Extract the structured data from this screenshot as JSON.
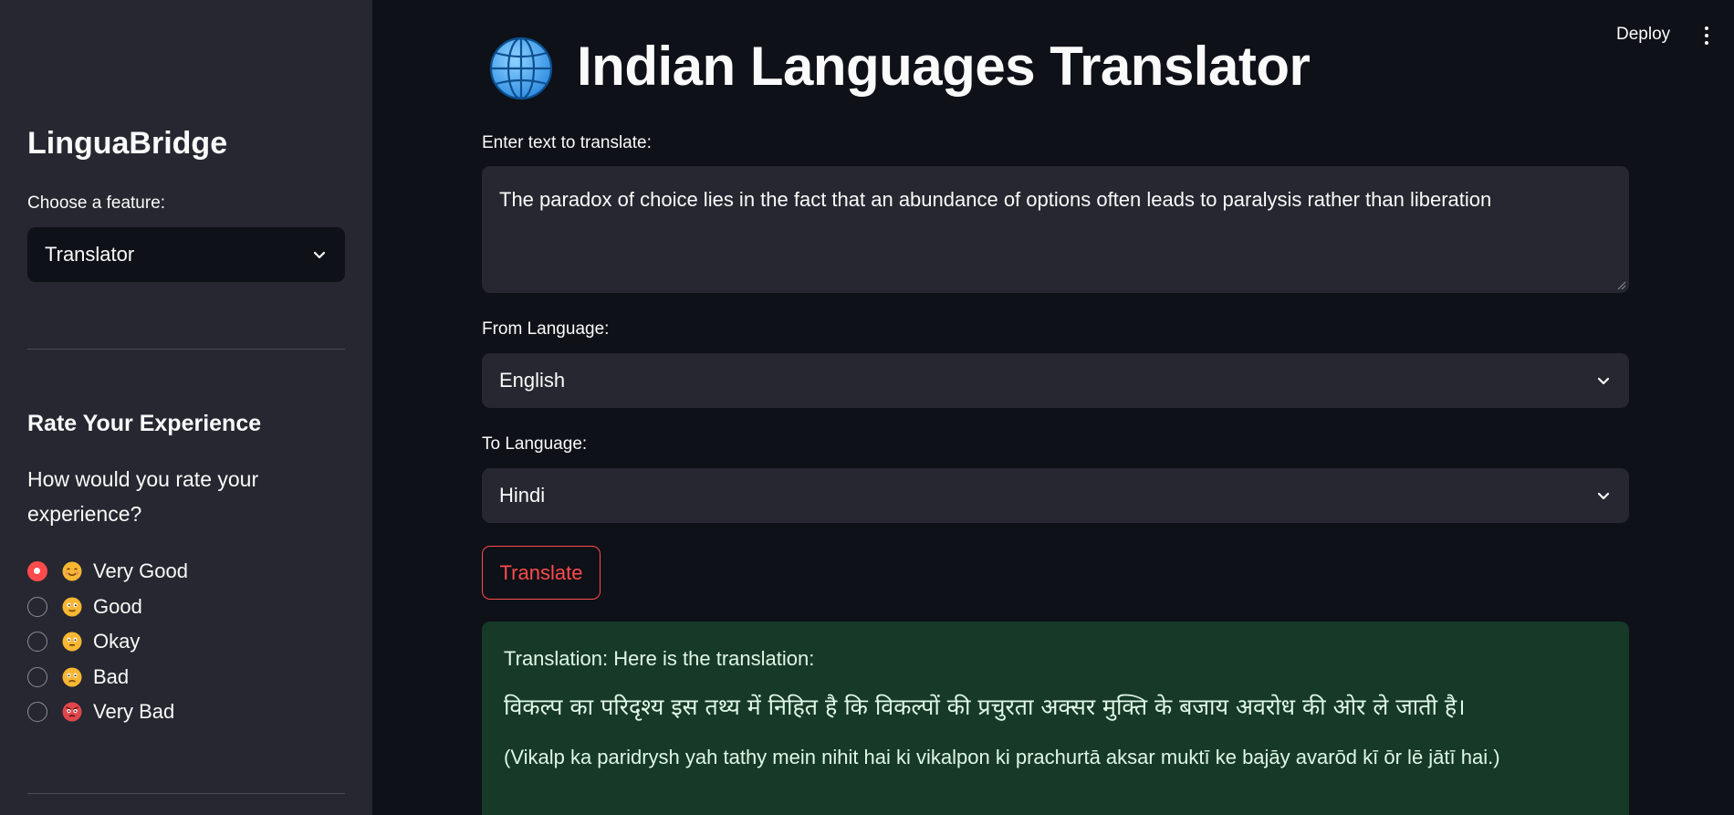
{
  "sidebar": {
    "app_name": "LinguaBridge",
    "feature_label": "Choose a feature:",
    "feature_selected": "Translator",
    "rate_title": "Rate Your Experience",
    "rate_question": "How would you rate your experience?",
    "rating_options": [
      {
        "label": "Very Good",
        "icon": "smiling-face-icon",
        "selected": true
      },
      {
        "label": "Good",
        "icon": "slightly-smiling-face-icon",
        "selected": false
      },
      {
        "label": "Okay",
        "icon": "neutral-face-icon",
        "selected": false
      },
      {
        "label": "Bad",
        "icon": "frowning-face-icon",
        "selected": false
      },
      {
        "label": "Very Bad",
        "icon": "angry-face-icon",
        "selected": false
      }
    ]
  },
  "header": {
    "deploy_label": "Deploy",
    "title": "Indian Languages Translator",
    "title_icon": "globe-icon"
  },
  "main": {
    "input_label": "Enter text to translate:",
    "input_value": "The paradox of choice lies in the fact that an abundance of options often leads to paralysis rather than liberation",
    "from_label": "From Language:",
    "from_value": "English",
    "to_label": "To Language:",
    "to_value": "Hindi",
    "translate_button": "Translate",
    "result": {
      "heading": "Translation: Here is the translation:",
      "translated_text": "विकल्प का परिदृश्य इस तथ्य में निहित है कि विकल्पों की प्रचुरता अक्सर मुक्ति के बजाय अवरोध की ओर ले जाती है।",
      "transliteration": "(Vikalp ka paridrysh yah tathy mein nihit hai ki vikalpon ki prachurtā aksar muktī ke bajāy avarōd kī ōr lē jātī hai.)"
    }
  },
  "colors": {
    "sidebar_bg": "#262730",
    "main_bg": "#0e1117",
    "accent": "#ff4b4b",
    "result_bg": "#173928"
  }
}
